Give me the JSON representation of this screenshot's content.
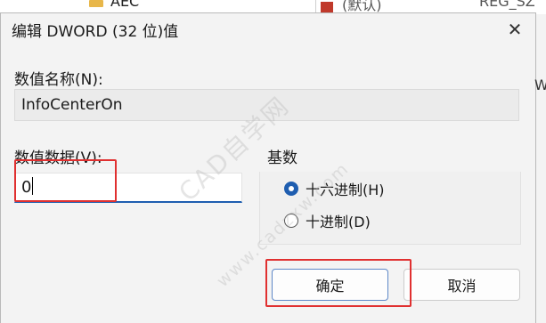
{
  "background": {
    "tree_item": "AEC",
    "list_item_name": "(默认)",
    "list_item_type": "REG_SZ",
    "list_item_edge": "W"
  },
  "dialog": {
    "title": "编辑 DWORD (32 位)值",
    "close_glyph": "✕",
    "name_label": "数值名称(N):",
    "name_value": "InfoCenterOn",
    "data_label": "数值数据(V):",
    "data_value": "0",
    "base_group_label": "基数",
    "base_options": [
      {
        "label": "十六进制(H)",
        "selected": true
      },
      {
        "label": "十进制(D)",
        "selected": false
      }
    ],
    "ok_label": "确定",
    "cancel_label": "取消"
  },
  "watermark": {
    "line1": "CAD自学网",
    "line2": "www.cadzxw.com"
  },
  "colors": {
    "highlight": "#e03030",
    "accent": "#1f5eb0"
  }
}
